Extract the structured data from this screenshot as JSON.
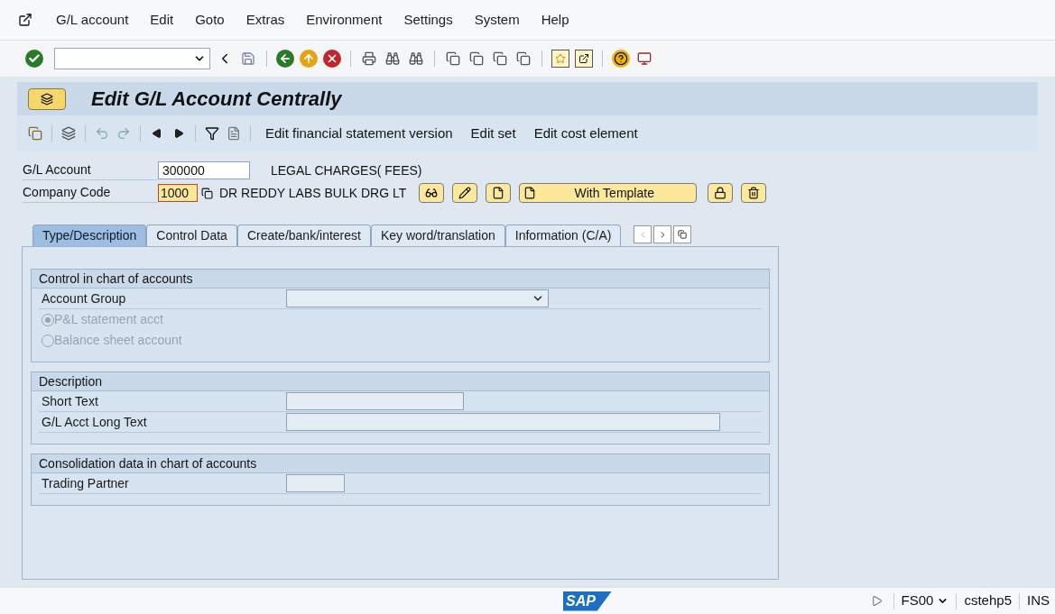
{
  "menu": [
    {
      "label": "G/L account"
    },
    {
      "label": "Edit"
    },
    {
      "label": "Goto"
    },
    {
      "label": "Extras"
    },
    {
      "label": "Environment"
    },
    {
      "label": "Settings"
    },
    {
      "label": "System"
    },
    {
      "label": "Help"
    }
  ],
  "title": "Edit G/L Account Centrally",
  "app_toolbar": [
    "Edit financial statement version",
    "Edit set",
    "Edit cost element"
  ],
  "header": {
    "gl_account": {
      "label": "G/L Account",
      "value": "300000",
      "description": "LEGAL CHARGES( FEES)"
    },
    "company_code": {
      "label": "Company Code",
      "value": "1000",
      "description": "DR REDDY LABS BULK DRG LT"
    },
    "template_button": "With Template"
  },
  "tabs": [
    {
      "label": "Type/Description",
      "selected": true
    },
    {
      "label": "Control Data",
      "selected": false
    },
    {
      "label": "Create/bank/interest",
      "selected": false
    },
    {
      "label": "Key word/translation",
      "selected": false
    },
    {
      "label": "Information (C/A)",
      "selected": false
    }
  ],
  "sections": [
    {
      "title": "Control in chart of accounts",
      "rows": [
        {
          "kind": "dropdown",
          "label": "Account Group"
        },
        {
          "kind": "radio",
          "label": "P&L statement acct",
          "selected": true,
          "disabled": true
        },
        {
          "kind": "radio",
          "label": "Balance sheet account",
          "selected": false,
          "disabled": true
        }
      ]
    },
    {
      "title": "Description",
      "rows": [
        {
          "kind": "medium_input",
          "label": "Short Text"
        },
        {
          "kind": "long_input",
          "label": "G/L Acct Long Text"
        }
      ]
    },
    {
      "title": "Consolidation data in chart of accounts",
      "rows": [
        {
          "kind": "short_input",
          "label": "Trading Partner"
        }
      ]
    }
  ],
  "status_bar": {
    "logo": "SAP",
    "transaction": "FS00",
    "user": "cstehp5",
    "mode": "INS"
  }
}
